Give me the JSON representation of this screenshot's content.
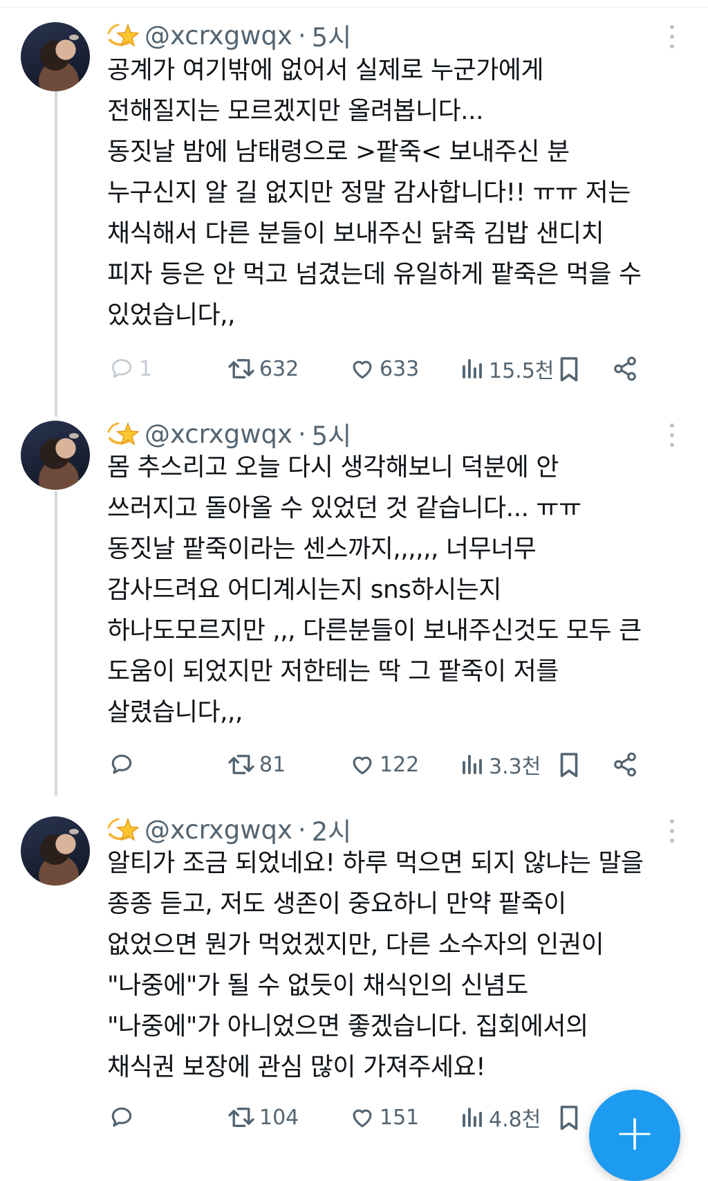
{
  "tweets": [
    {
      "handle": "@xcrxgwqx",
      "separator": "·",
      "time": "5시",
      "text": "공계가 여기밖에 없어서 실제로 누군가에게\n전해질지는 모르겠지만 올려봅니다...\n동짓날 밤에 남태령으로 >팥죽< 보내주신 분\n누구신지 알 길 없지만 정말 감사합니다!! ㅠㅠ 저는\n채식해서 다른 분들이 보내주신 닭죽 김밥 샌디치\n피자 등은 안 먹고 넘겼는데 유일하게 팥죽은 먹을 수\n있었습니다,,",
      "replies": "1",
      "retweets": "632",
      "likes": "633",
      "views": "15.5천"
    },
    {
      "handle": "@xcrxgwqx",
      "separator": "·",
      "time": "5시",
      "text": "몸 추스리고 오늘 다시 생각해보니 덕분에 안\n쓰러지고 돌아올 수 있었던 것 같습니다... ㅠㅠ\n동짓날 팥죽이라는 센스까지,,,,,, 너무너무\n감사드려요 어디계시는지 sns하시는지\n하나도모르지만 ,,, 다른분들이 보내주신것도 모두 큰\n도움이 되었지만 저한테는 딱 그 팥죽이 저를\n살렸습니다,,,",
      "replies": "",
      "retweets": "81",
      "likes": "122",
      "views": "3.3천"
    },
    {
      "handle": "@xcrxgwqx",
      "separator": "·",
      "time": "2시",
      "text": "알티가 조금 되었네요! 하루 먹으면 되지 않냐는 말을\n종종 듣고, 저도 생존이 중요하니 만약 팥죽이\n없었으면 뭔가 먹었겠지만, 다른 소수자의 인권이\n\"나중에\"가 될 수 없듯이 채식인의 신념도\n\"나중에\"가 아니었으면 좋겠습니다. 집회에서의\n채식권 보장에 관심 많이 가져주세요!",
      "replies": "",
      "retweets": "104",
      "likes": "151",
      "views": "4.8천"
    }
  ],
  "fab": {
    "label": "+",
    "color": "#1d9bf0"
  },
  "icons": {
    "name_emoji": "dizzy-star-icon",
    "reply": "reply-icon",
    "retweet": "retweet-icon",
    "like": "heart-icon",
    "views": "views-chart-icon",
    "bookmark": "bookmark-icon",
    "share": "share-icon",
    "more": "more-vertical-icon"
  },
  "colors": {
    "text": "#0f1419",
    "muted": "#536471",
    "thread_line": "#cfd9de",
    "accent": "#1d9bf0"
  }
}
